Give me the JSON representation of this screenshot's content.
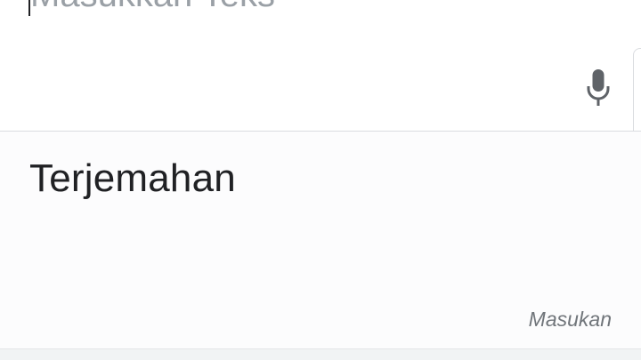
{
  "source": {
    "placeholder": "Masukkan Teks",
    "value": ""
  },
  "mic": {
    "icon": "microphone-icon",
    "color": "#5f6368"
  },
  "output": {
    "translation_placeholder": "Terjemahan",
    "input_label": "Masukan"
  }
}
